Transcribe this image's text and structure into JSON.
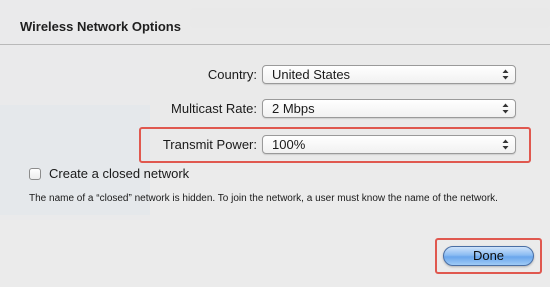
{
  "dialog": {
    "title": "Wireless Network Options"
  },
  "form": {
    "country": {
      "label": "Country:",
      "value": "United States"
    },
    "multicast_rate": {
      "label": "Multicast Rate:",
      "value": "2 Mbps"
    },
    "transmit_power": {
      "label": "Transmit Power:",
      "value": "100%"
    }
  },
  "closed_network": {
    "label": "Create a closed network",
    "checked": false,
    "help": "The name of a “closed” network is hidden. To join the network, a user must know the name of the network."
  },
  "buttons": {
    "done_label": "Done"
  },
  "colors": {
    "highlight": "#e0584f",
    "done_button": "#8bbcf2"
  },
  "icons": {
    "popup_arrows": "up-down-chevron-icon"
  }
}
